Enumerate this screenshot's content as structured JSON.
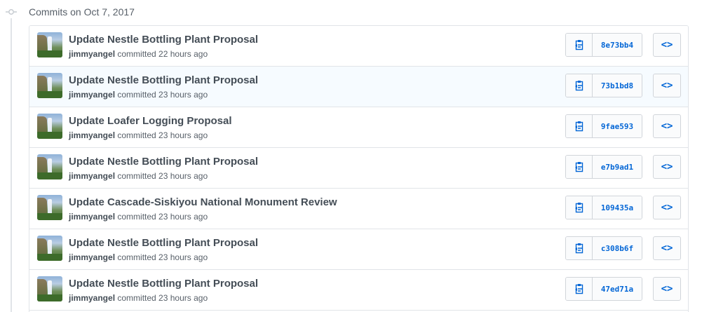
{
  "header": {
    "title": "Commits on Oct 7, 2017"
  },
  "commits": [
    {
      "title": "Update Nestle Bottling Plant Proposal",
      "author": "jimmyangel",
      "time": "committed 22 hours ago",
      "sha": "8e73bb4"
    },
    {
      "title": "Update Nestle Bottling Plant Proposal",
      "author": "jimmyangel",
      "time": "committed 23 hours ago",
      "sha": "73b1bd8"
    },
    {
      "title": "Update Loafer Logging Proposal",
      "author": "jimmyangel",
      "time": "committed 23 hours ago",
      "sha": "9fae593"
    },
    {
      "title": "Update Nestle Bottling Plant Proposal",
      "author": "jimmyangel",
      "time": "committed 23 hours ago",
      "sha": "e7b9ad1"
    },
    {
      "title": "Update Cascade-Siskiyou National Monument Review",
      "author": "jimmyangel",
      "time": "committed 23 hours ago",
      "sha": "109435a"
    },
    {
      "title": "Update Nestle Bottling Plant Proposal",
      "author": "jimmyangel",
      "time": "committed 23 hours ago",
      "sha": "c308b6f"
    },
    {
      "title": "Update Nestle Bottling Plant Proposal",
      "author": "jimmyangel",
      "time": "committed 23 hours ago",
      "sha": "47ed71a"
    }
  ],
  "icons": {
    "commit": "git-commit-icon",
    "copy": "clipboard-icon",
    "browse": "code-icon"
  },
  "colors": {
    "link": "#0366d6",
    "border": "#e1e4e8",
    "hover_row": "#f6fbff"
  },
  "browse_label": "<>"
}
